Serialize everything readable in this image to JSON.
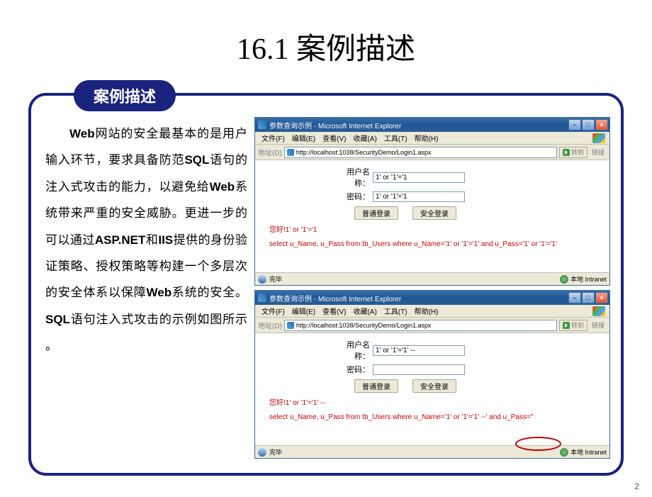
{
  "slide": {
    "title": "16.1 案例描述",
    "badge": "案例描述",
    "page_num": "2"
  },
  "body_text": "Web网站的安全最基本的是用户输入环节，要求具备防范SQL语句的注入式攻击的能力，以避免给Web系统带来严重的安全威胁。更进一步的可以通过ASP.NET和IIS提供的身份验证策略、授权策略等构建一个多层次的安全体系以保障Web系统的安全。SQL语句注入式攻击的示例如图所示 。",
  "ie_common": {
    "title": "参数查询示例 - Microsoft Internet Explorer",
    "menu": {
      "file": "文件(F)",
      "edit": "编辑(E)",
      "view": "查看(V)",
      "fav": "收藏(A)",
      "tools": "工具(T)",
      "help": "帮助(H)"
    },
    "addr_label": "地址(D)",
    "url": "http://localhost:1038/SecurityDemo/Login1.aspx",
    "go": "转到",
    "link_label": "链接",
    "form": {
      "user_label": "用户名称：",
      "pass_label": "密码：",
      "btn1": "普通登录",
      "btn2": "安全登录"
    },
    "status_done": "完毕",
    "status_zone": "本地 Intranet"
  },
  "screen1": {
    "user_value": "1' or '1'='1",
    "pass_value": "1' or '1'='1",
    "msg1": "您好!1' or '1'='1",
    "msg2": "select u_Name, u_Pass from tb_Users where u_Name='1' or '1'='1' and u_Pass='1' or '1'='1'"
  },
  "screen2": {
    "user_value": "1' or '1'='1' --",
    "pass_value": "",
    "msg1": "您好!1' or '1'='1' --",
    "msg2": "select u_Name, u_Pass from tb_Users where u_Name='1' or '1'='1' --' and u_Pass=''"
  }
}
